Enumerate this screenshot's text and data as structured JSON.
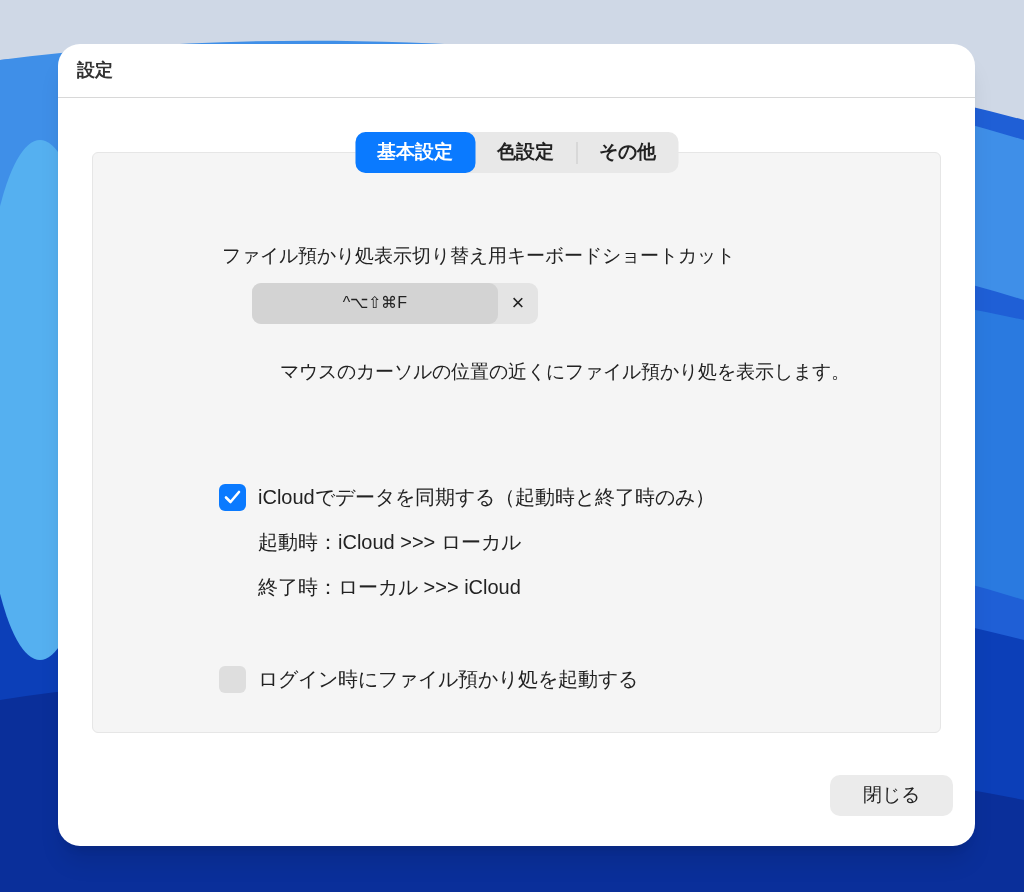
{
  "window": {
    "title": "設定"
  },
  "tabs": [
    {
      "label": "基本設定",
      "selected": true
    },
    {
      "label": "色設定",
      "selected": false
    },
    {
      "label": "その他",
      "selected": false
    }
  ],
  "shortcut": {
    "label": "ファイル預かり処表示切り替え用キーボードショートカット",
    "value": "^⌥⇧⌘F",
    "clear": "×",
    "description": "マウスのカーソルの位置の近くにファイル預かり処を表示します。"
  },
  "options": [
    {
      "label": "iCloudでデータを同期する（起動時と終了時のみ）",
      "checked": true,
      "notes": [
        "起動時：iCloud >>> ローカル",
        "終了時：ローカル >>> iCloud"
      ]
    },
    {
      "label": "ログイン時にファイル預かり処を起動する",
      "checked": false
    }
  ],
  "buttons": [
    {
      "label": "閉じる"
    }
  ]
}
